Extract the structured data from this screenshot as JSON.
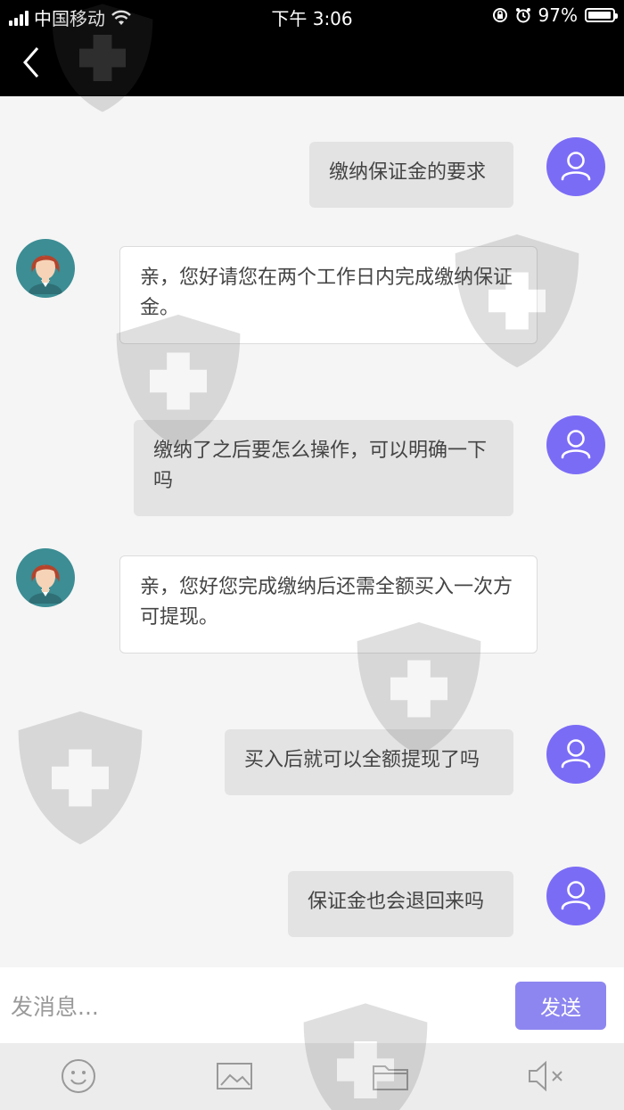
{
  "status_bar": {
    "carrier": "中国移动",
    "time": "下午 3:06",
    "battery": "97%",
    "battery_level": 0.97
  },
  "nav": {
    "back_icon": "chevron-left-icon"
  },
  "messages": [
    {
      "sender": "user",
      "text": "缴纳保证金的要求"
    },
    {
      "sender": "agent",
      "text": "亲，您好请您在两个工作日内完成缴纳保证金。"
    },
    {
      "sender": "user",
      "text": "缴纳了之后要怎么操作，可以明确一下吗"
    },
    {
      "sender": "agent",
      "text": "亲，您好您完成缴纳后还需全额买入一次方可提现。"
    },
    {
      "sender": "user",
      "text": "买入后就可以全额提现了吗"
    },
    {
      "sender": "user",
      "text": "保证金也会退回来吗"
    }
  ],
  "composer": {
    "placeholder": "发消息...",
    "value": "",
    "send_label": "发送"
  },
  "toolbar": {
    "icons": [
      "smiley-icon",
      "image-icon",
      "folder-icon",
      "speaker-mute-icon"
    ]
  },
  "colors": {
    "accent": "#7b6cf6",
    "send_button": "#8d86f0",
    "user_bubble": "#e3e3e3",
    "agent_bubble": "#ffffff"
  }
}
